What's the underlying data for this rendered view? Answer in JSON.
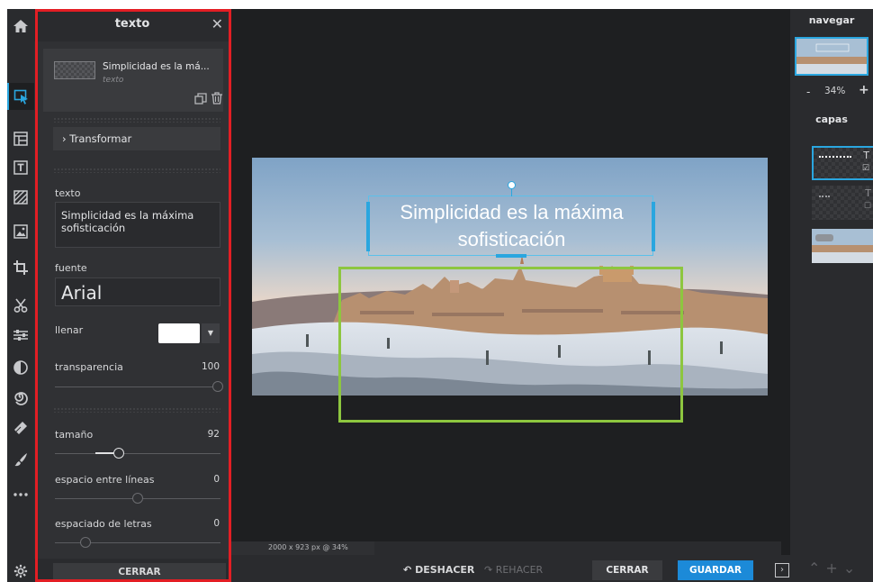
{
  "panel": {
    "title": "texto",
    "layer_name": "Simplicidad es la má...",
    "layer_type": "texto",
    "transform_label": "Transformar",
    "text_label": "texto",
    "text_value": "Simplicidad es la máxima sofisticación",
    "font_label": "fuente",
    "font_value": "Arial",
    "fill_label": "llenar",
    "fill_color": "#ffffff",
    "opacity_label": "transparencia",
    "opacity_value": "100",
    "opacity_level": 1.0,
    "size_label": "tamaño",
    "size_value": "92",
    "line_spacing_label": "espacio entre líneas",
    "line_spacing_value": "0",
    "letter_spacing_label": "espaciado de letras",
    "letter_spacing_value": "0",
    "close_label": "CERRAR"
  },
  "toolbar": {
    "items": [
      "home-icon",
      "select-icon",
      "layout-icon",
      "text-tool-icon",
      "pattern-icon",
      "image-icon",
      "crop-icon",
      "cut-icon",
      "adjust-icon",
      "filter-icon",
      "swirl-icon",
      "eraser-icon",
      "brush-icon",
      "more-icon"
    ],
    "active": "select-icon",
    "settings": "gear-icon"
  },
  "canvas": {
    "overlay_text": "Simplicidad es la máxima sofisticación",
    "status": "2000 x 923 px @ 34%"
  },
  "bottom_bar": {
    "undo_label": "DESHACER",
    "redo_label": "REHACER",
    "close_label": "CERRAR",
    "save_label": "GUARDAR"
  },
  "right_panel": {
    "nav_title": "navegar",
    "zoom_minus": "-",
    "zoom_level": "34%",
    "zoom_plus": "+",
    "layers_title": "capas"
  },
  "colors": {
    "accent": "#2aa6df",
    "save_button": "#1c8ad8",
    "highlight_red": "#e31e24",
    "highlight_green": "#8dc63f"
  }
}
